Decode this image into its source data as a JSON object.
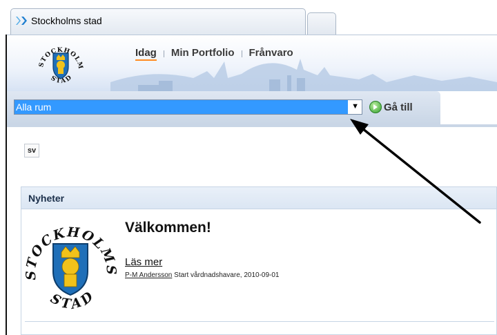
{
  "browser": {
    "tab_title": "Stockholms stad"
  },
  "header": {
    "nav": [
      {
        "label": "Idag",
        "active": true
      },
      {
        "label": "Min Portfolio",
        "active": false
      },
      {
        "label": "Frånvaro",
        "active": false
      }
    ],
    "logo_text": "STOCKHOLMS STAD"
  },
  "room_selector": {
    "selected": "Alla rum",
    "goto_label": "Gå till"
  },
  "language": {
    "code": "sv"
  },
  "news": {
    "heading": "Nyheter",
    "items": [
      {
        "title": "Välkommen!",
        "read_more": "Läs mer",
        "author": "P-M Andersson",
        "meta": " Start vårdnadshavare, 2010-09-01"
      }
    ]
  },
  "colors": {
    "accent_underline": "#ff8a1f",
    "selection_blue": "#3399ff",
    "header_blue": "#d7e3f4",
    "shield_blue": "#1f6fb8",
    "crown_gold": "#f2c21b"
  }
}
